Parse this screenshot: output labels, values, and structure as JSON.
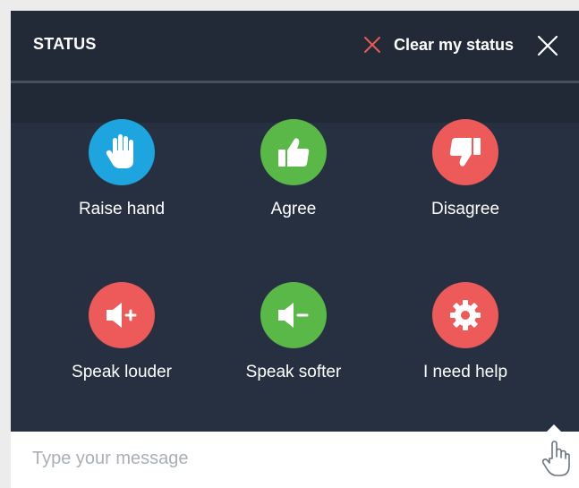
{
  "header": {
    "title": "STATUS",
    "clear_label": "Clear my status",
    "clear_icon": "x-icon",
    "close_icon": "close-icon"
  },
  "actions": [
    {
      "label": "Raise hand",
      "icon": "raise-hand-icon",
      "color": "#1ea5df"
    },
    {
      "label": "Agree",
      "icon": "thumbs-up-icon",
      "color": "#5ab848"
    },
    {
      "label": "Disagree",
      "icon": "thumbs-down-icon",
      "color": "#ec5a5a"
    },
    {
      "label": "Speak louder",
      "icon": "volume-up-icon",
      "color": "#ec5a5a"
    },
    {
      "label": "Speak softer",
      "icon": "volume-down-icon",
      "color": "#5ab848"
    },
    {
      "label": "I need help",
      "icon": "gear-icon",
      "color": "#ec5a5a"
    }
  ],
  "composer": {
    "placeholder": "Type your message",
    "value": "",
    "icon": "hand-pointer-icon"
  },
  "colors": {
    "panel_bg": "#273040",
    "header_bg": "#222a37",
    "accent_red": "#ec5a5a",
    "accent_green": "#5ab848",
    "accent_blue": "#1ea5df"
  }
}
